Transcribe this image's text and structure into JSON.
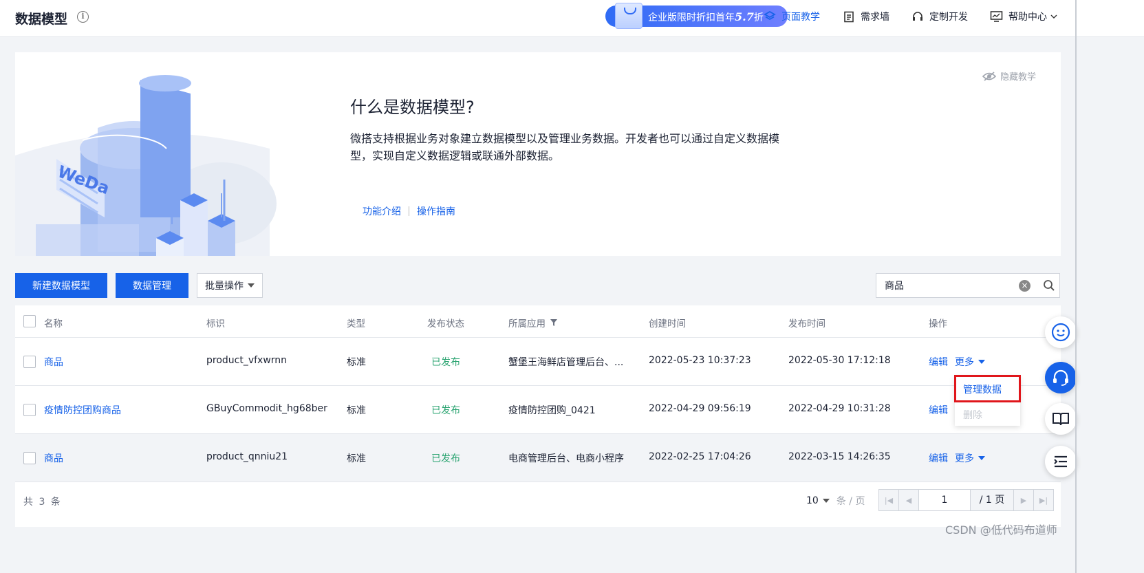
{
  "header": {
    "title": "数据模型",
    "promo": {
      "text": "企业版限时折扣首年",
      "discount": "5.7",
      "suffix": "折"
    },
    "nav": [
      {
        "label": "页面教学",
        "icon": "layers-icon",
        "active": true
      },
      {
        "label": "需求墙",
        "icon": "clipboard-icon",
        "active": false
      },
      {
        "label": "定制开发",
        "icon": "headset-icon",
        "active": false
      },
      {
        "label": "帮助中心",
        "icon": "monitor-icon",
        "active": false
      }
    ]
  },
  "banner": {
    "title": "什么是数据模型?",
    "description": "微搭支持根据业务对象建立数据模型以及管理业务数据。开发者也可以通过自定义数据模型，实现自定义数据逻辑或联通外部数据。",
    "links": [
      "功能介绍",
      "操作指南"
    ],
    "hide_label": "隐藏教学",
    "illustration_text": "WeDa"
  },
  "toolbar": {
    "create_label": "新建数据模型",
    "manage_label": "数据管理",
    "batch_label": "批量操作",
    "search_value": "商品"
  },
  "table": {
    "columns": [
      "名称",
      "标识",
      "类型",
      "发布状态",
      "所属应用",
      "创建时间",
      "发布时间",
      "操作"
    ],
    "rows": [
      {
        "name": "商品",
        "id": "product_vfxwrnn",
        "type": "标准",
        "status": "已发布",
        "app": "蟹堡王海鲜店管理后台、...",
        "created": "2022-05-23 10:37:23",
        "published": "2022-05-30 17:12:18",
        "edit": "编辑",
        "more": "更多"
      },
      {
        "name": "疫情防控团购商品",
        "id": "GBuyCommodit_hg68ber",
        "type": "标准",
        "status": "已发布",
        "app": "疫情防控团购_0421",
        "created": "2022-04-29 09:56:19",
        "published": "2022-04-29 10:31:28",
        "edit": "编辑",
        "more": ""
      },
      {
        "name": "商品",
        "id": "product_qnniu21",
        "type": "标准",
        "status": "已发布",
        "app": "电商管理后台、电商小程序",
        "created": "2022-02-25 17:04:26",
        "published": "2022-03-15 14:26:35",
        "edit": "编辑",
        "more": "更多"
      }
    ]
  },
  "dropdown": {
    "items": [
      "管理数据",
      "删除"
    ]
  },
  "footer": {
    "total": "共 3 条",
    "page_size": "10",
    "page_size_unit": "条 / 页",
    "current_page": "1",
    "total_pages": "/ 1 页"
  },
  "watermark": "CSDN @低代码布道师",
  "colors": {
    "primary": "#1762e8",
    "success": "#2ba471",
    "highlight": "#e0161b"
  }
}
